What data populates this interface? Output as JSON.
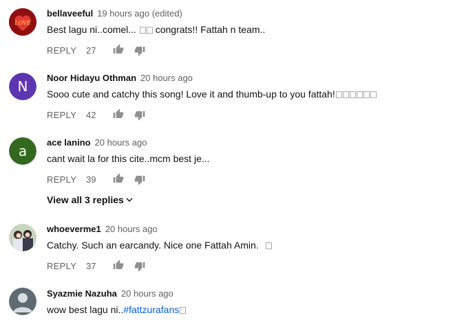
{
  "reply_label": "REPLY",
  "colors": {
    "link": "#065fd4",
    "meta": "#606060",
    "icon": "#909090"
  },
  "comments": [
    {
      "author": "bellaveeful",
      "time": "19 hours ago (edited)",
      "text_pre": "Best lagu ni..comel...",
      "text_post": "congrats!! Fattah n team..",
      "likes": "27",
      "avatar_label": "LOVE",
      "avatar_icon": "heart-avatar"
    },
    {
      "author": "Noor Hidayu Othman",
      "time": "20 hours ago",
      "text_pre": "Sooo cute and catchy this song! Love it and thumb-up to you fattah!",
      "likes": "42",
      "avatar_letter": "N",
      "avatar_color": "#5e35b1"
    },
    {
      "author": "ace lanino",
      "time": "20 hours ago",
      "text_pre": "cant wait la for this cite..mcm best je...",
      "likes": "39",
      "avatar_letter": "a",
      "avatar_color": "#33691e"
    },
    {
      "author": "whoeverme1",
      "time": "20 hours ago",
      "text_pre": "Catchy. Such an earcandy. Nice one Fattah Amin.",
      "likes": "37",
      "avatar_icon": "photo-avatar"
    },
    {
      "author": "Syazmie Nazuha",
      "time": "20 hours ago",
      "text_pre": "wow best lagu ni..",
      "hashtag": "#fattzurafans",
      "avatar_icon": "default-person-avatar"
    }
  ],
  "view_replies": "View all 3 replies"
}
